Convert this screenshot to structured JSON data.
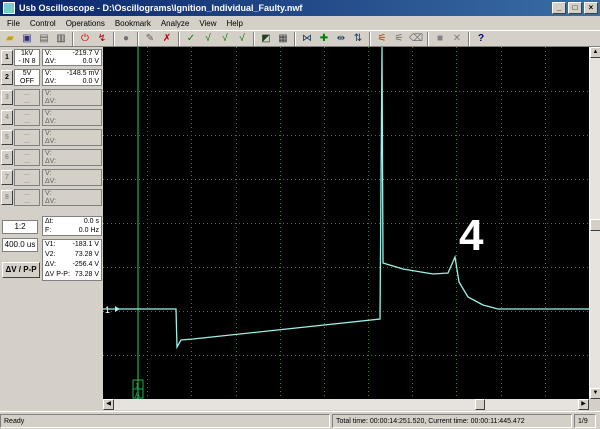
{
  "window": {
    "title": "Usb Oscilloscope - D:\\Oscillograms\\Ignition_Individual_Faulty.nwf"
  },
  "menu": [
    "File",
    "Control",
    "Operations",
    "Bookmark",
    "Analyze",
    "View",
    "Help"
  ],
  "toolbar": {
    "icons": [
      "open-icon",
      "save-icon",
      "save-as-icon",
      "print-icon",
      "stop-icon",
      "reverse-icon",
      "record-icon",
      "cursor-add-icon",
      "cursor-delete-icon",
      "check-icon",
      "check-v1-icon",
      "check-v2-icon",
      "check-v3-icon",
      "invert-icon",
      "grid-icon",
      "marker-icon",
      "move-icon",
      "split-icon",
      "align-icon",
      "probe-icon",
      "probe-off-icon",
      "erase-icon",
      "stop-square-icon",
      "close-icon",
      "help-icon"
    ]
  },
  "channels": [
    {
      "id": "1",
      "setting1": "1kV",
      "setting2": "- IN 8",
      "v_label": "V:",
      "v_value": "-219.7 V",
      "dv_label": "ΔV:",
      "dv_value": "0.0 V",
      "active": true
    },
    {
      "id": "2",
      "setting1": "5V",
      "setting2": "OFF",
      "v_label": "V:",
      "v_value": "-148.5 mV",
      "dv_label": "ΔV:",
      "dv_value": "0.0 V",
      "active": true
    },
    {
      "id": "3",
      "setting1": "...",
      "setting2": "...",
      "v_label": "V:",
      "v_value": "",
      "dv_label": "ΔV:",
      "dv_value": "",
      "active": false
    },
    {
      "id": "4",
      "setting1": "...",
      "setting2": "...",
      "v_label": "V:",
      "v_value": "",
      "dv_label": "ΔV:",
      "dv_value": "",
      "active": false
    },
    {
      "id": "5",
      "setting1": "...",
      "setting2": "...",
      "v_label": "V:",
      "v_value": "",
      "dv_label": "ΔV:",
      "dv_value": "",
      "active": false
    },
    {
      "id": "6",
      "setting1": "...",
      "setting2": "...",
      "v_label": "V:",
      "v_value": "",
      "dv_label": "ΔV:",
      "dv_value": "",
      "active": false
    },
    {
      "id": "7",
      "setting1": "...",
      "setting2": "...",
      "v_label": "V:",
      "v_value": "",
      "dv_label": "ΔV:",
      "dv_value": "",
      "active": false
    },
    {
      "id": "8",
      "setting1": "...",
      "setting2": "...",
      "v_label": "V:",
      "v_value": "",
      "dv_label": "ΔV:",
      "dv_value": "",
      "active": false
    }
  ],
  "controls": {
    "scale": "1:2",
    "timebase": "400.0 us",
    "mode_button": "ΔV / P-P"
  },
  "time_meas": {
    "dt_label": "Δt:",
    "dt_value": "0.0 s",
    "f_label": "F:",
    "f_value": "0.0 Hz"
  },
  "volt_meas": {
    "v1_label": "V1:",
    "v1_value": "-183.1 V",
    "v2_label": "V2:",
    "v2_value": "73.28 V",
    "dv_label": "ΔV:",
    "dv_value": "-256.4 V",
    "dvpp_label": "ΔV P-P:",
    "dvpp_value": "73.28 V"
  },
  "scope": {
    "background": "#000000",
    "grid_color": "#3c7a3c",
    "trace_color": "#9cf0e6",
    "channel_marker": "1",
    "annotation": "4",
    "cursor_label_top": "1",
    "cursor_label_bottom": "A"
  },
  "status": {
    "ready": "Ready",
    "total_time": "Total time: 00:00:14:251.520, Current time: 00:00:11:445.472",
    "page": "1/9"
  }
}
